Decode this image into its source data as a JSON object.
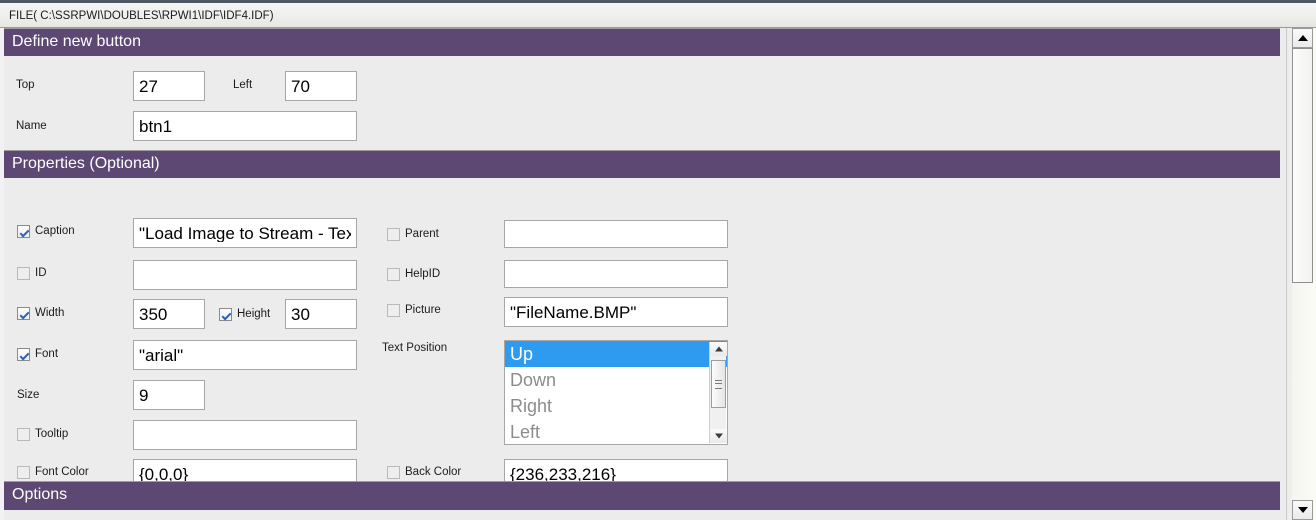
{
  "titlebar": {
    "text": "FILE( C:\\SSRPWI\\DOUBLES\\RPWI1\\IDF\\IDF4.IDF)"
  },
  "sections": {
    "define": "Define new button",
    "properties": "Properties (Optional)",
    "options": "Options"
  },
  "define_panel": {
    "top_label": "Top",
    "top_value": "27",
    "left_label": "Left",
    "left_value": "70",
    "name_label": "Name",
    "name_value": "btn1"
  },
  "properties": {
    "left_column": [
      {
        "label": "Caption",
        "checked": true,
        "value": "\"Load Image to Stream - Text\""
      },
      {
        "label": "ID",
        "checked": false,
        "value": ""
      },
      {
        "label": "Width",
        "checked": true,
        "value": "350"
      },
      {
        "label": "Height",
        "checked": true,
        "value": "30"
      },
      {
        "label": "Font",
        "checked": true,
        "value": "\"arial\""
      },
      {
        "label": "Size",
        "checked": null,
        "value": "9"
      },
      {
        "label": "Tooltip",
        "checked": false,
        "value": ""
      },
      {
        "label": "Font Color",
        "checked": false,
        "value": "{0,0,0}"
      }
    ],
    "right_column": [
      {
        "label": "Parent",
        "checked": false,
        "value": ""
      },
      {
        "label": "HelpID",
        "checked": false,
        "value": ""
      },
      {
        "label": "Picture",
        "checked": false,
        "value": "\"FileName.BMP\""
      },
      {
        "label": "Back Color",
        "checked": false,
        "value": "{236,233,216}"
      }
    ],
    "text_position": {
      "label": "Text Position",
      "options": [
        "Up",
        "Down",
        "Right",
        "Left"
      ],
      "selected": "Up"
    }
  },
  "colors": {
    "header_purple": "#5c4873",
    "panel_gray": "#ececec",
    "selection_blue": "#2e9bf0",
    "check_blue": "#2f62b8"
  }
}
